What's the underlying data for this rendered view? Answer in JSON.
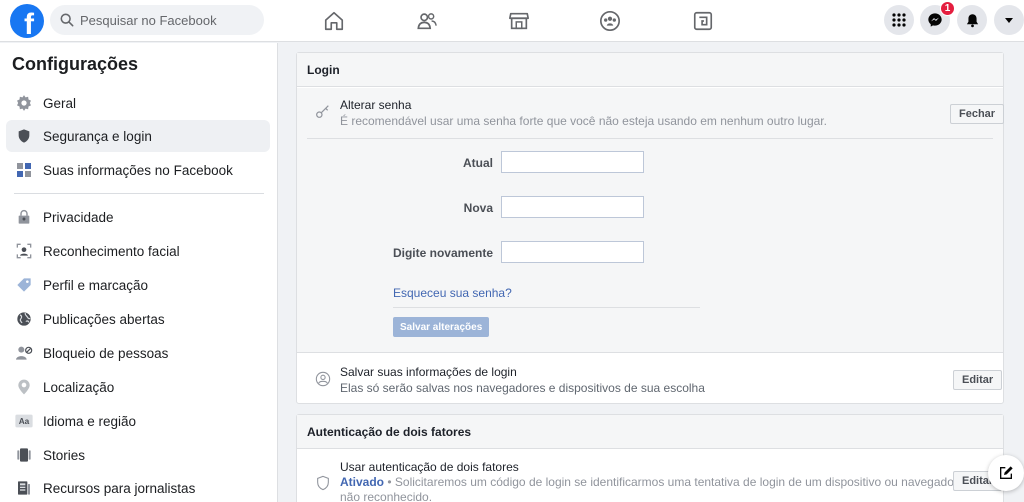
{
  "topbar": {
    "logo_letter": "f",
    "search_placeholder": "Pesquisar no Facebook",
    "messenger_badge": "1"
  },
  "sidebar": {
    "title": "Configurações",
    "items": [
      {
        "label": "Geral",
        "icon": "gear-icon"
      },
      {
        "label": "Segurança e login",
        "icon": "shield-icon"
      },
      {
        "label": "Suas informações no Facebook",
        "icon": "grid-icon"
      },
      {
        "label": "Privacidade",
        "icon": "lock-icon"
      },
      {
        "label": "Reconhecimento facial",
        "icon": "face-icon"
      },
      {
        "label": "Perfil e marcação",
        "icon": "tag-icon"
      },
      {
        "label": "Publicações abertas",
        "icon": "globe-icon"
      },
      {
        "label": "Bloqueio de pessoas",
        "icon": "block-user-icon"
      },
      {
        "label": "Localização",
        "icon": "location-pin-icon"
      },
      {
        "label": "Idioma e região",
        "icon": "language-icon"
      },
      {
        "label": "Stories",
        "icon": "stories-icon"
      },
      {
        "label": "Recursos para jornalistas",
        "icon": "journalist-icon"
      }
    ]
  },
  "login_panel": {
    "header": "Login",
    "change_password": {
      "title": "Alterar senha",
      "desc": "É recomendável usar uma senha forte que você não esteja usando em nenhum outro lugar.",
      "close_label": "Fechar",
      "current_label": "Atual",
      "new_label": "Nova",
      "retype_label": "Digite novamente",
      "current_value": "",
      "new_value": "",
      "retype_value": "",
      "forgot_link": "Esqueceu sua senha?",
      "save_label": "Salvar alterações"
    },
    "save_login": {
      "title": "Salvar suas informações de login",
      "desc": "Elas só serão salvas nos navegadores e dispositivos de sua escolha",
      "edit_label": "Editar"
    }
  },
  "twofa_panel": {
    "header": "Autenticação de dois fatores",
    "use_2fa": {
      "title": "Usar autenticação de dois fatores",
      "status": "Ativado",
      "desc_line1": " • Solicitaremos um código de login se identificarmos uma tentativa de login de um dispositivo ou navegador",
      "desc_line2": "não reconhecido.",
      "edit_label": "Editar"
    }
  },
  "colors": {
    "brand": "#1877f2",
    "link": "#4267b2",
    "badge": "#e41e3f"
  }
}
